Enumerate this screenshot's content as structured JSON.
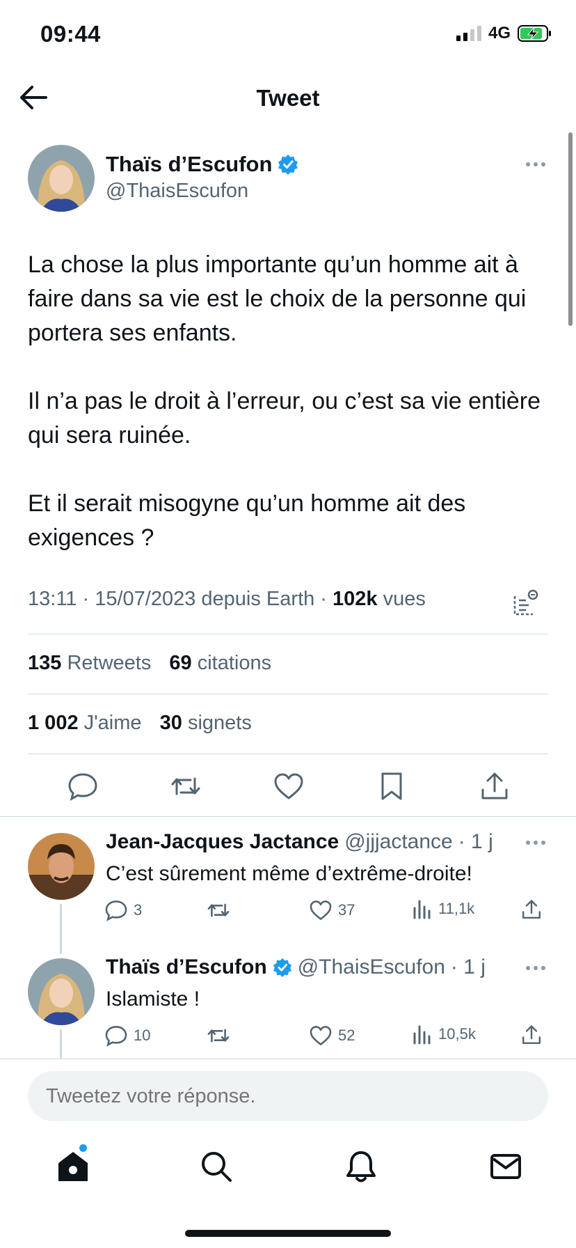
{
  "status_bar": {
    "time": "09:44",
    "network": "4G",
    "battery_level": 0.85
  },
  "header": {
    "title": "Tweet",
    "back_icon": "arrow-left-icon"
  },
  "tweet": {
    "author": {
      "name": "Thaïs d’Escufon",
      "handle": "@ThaisEscufon",
      "verified": true
    },
    "paragraphs": [
      "La chose la plus importante qu’un homme ait à faire dans sa vie est le choix de la personne qui portera ses enfants.",
      "Il n’a pas le droit à l’erreur, ou c’est sa vie entière qui sera ruinée.",
      "Et il serait misogyne qu’un homme ait des exigences ?"
    ],
    "meta": {
      "time": "13:11",
      "date": "15/07/2023",
      "source": "depuis Earth",
      "views": "102k",
      "views_label": "vues"
    },
    "stats": {
      "retweets": "135",
      "retweets_label": "Retweets",
      "quotes": "69",
      "quotes_label": "citations",
      "likes": "1 002",
      "likes_label": "J'aime",
      "bookmarks": "30",
      "bookmarks_label": "signets"
    }
  },
  "replies": [
    {
      "name": "Jean-Jacques Jactance",
      "handle": "@jjjactance",
      "time": "· 1 j",
      "verified": false,
      "text": "C’est sûrement même d’extrême-droite!",
      "replies": "3",
      "retweets": "",
      "likes": "37",
      "views": "11,1k"
    },
    {
      "name": "Thaïs d’Escufon",
      "handle": "@ThaisEscufon",
      "time": "· 1 j",
      "verified": true,
      "text": "Islamiste !",
      "replies": "10",
      "retweets": "",
      "likes": "52",
      "views": "10,5k"
    }
  ],
  "reply_input": {
    "placeholder": "Tweetez votre réponse."
  },
  "tab_bar": {
    "items": [
      "home-icon",
      "search-icon",
      "notifications-icon",
      "messages-icon"
    ]
  },
  "colors": {
    "accent": "#1d9bf0",
    "text": "#0f1419",
    "muted": "#536471",
    "divider": "#cfd9de"
  }
}
